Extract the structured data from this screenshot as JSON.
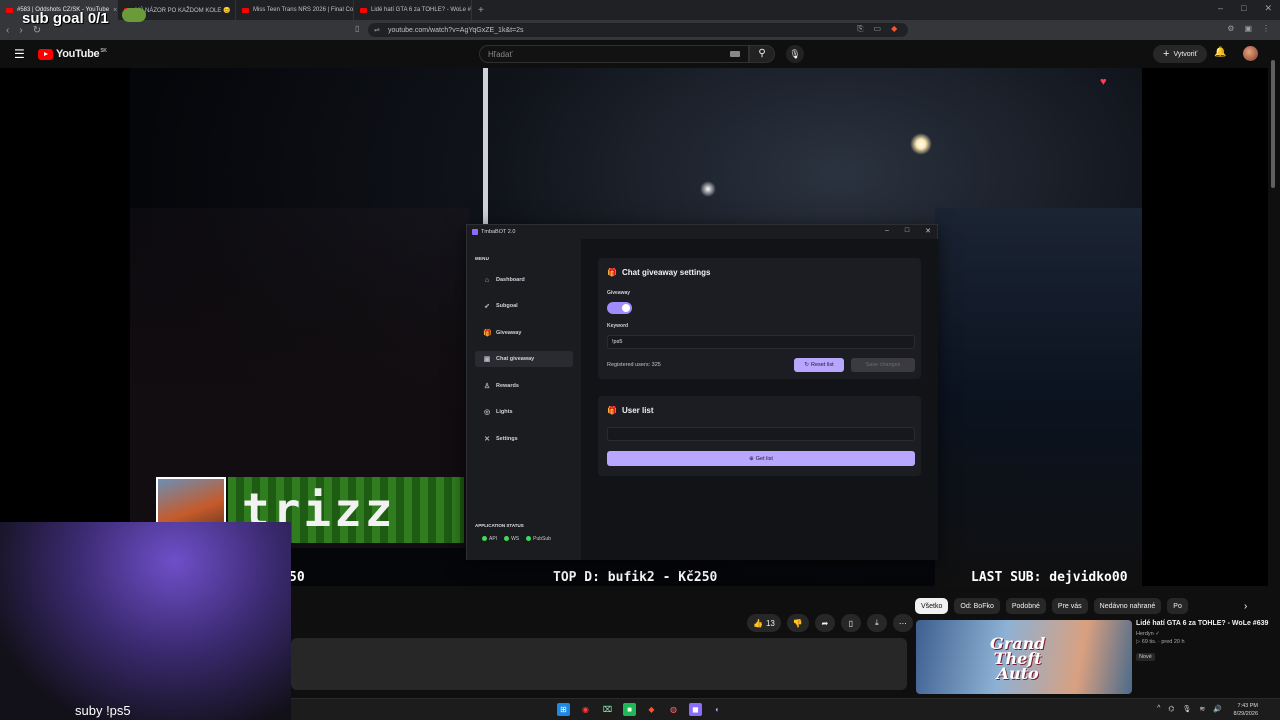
{
  "browser": {
    "tabs": [
      {
        "label": "#583 | Oddshots CZ/SK - YouTube",
        "active": true
      },
      {
        "label": "NÝ NÁZOR PO KAŽDOM KOLE 😊",
        "active": false
      },
      {
        "label": "Miss Teen Trans NRS 2026 | Final Co",
        "active": false
      },
      {
        "label": "Lidé hatí GTA 6 za TOHLE? - WoLe #",
        "active": false
      }
    ],
    "new_tab": "+",
    "url": "youtube.com/watch?v=AgYqGxZE_1k&t=2s"
  },
  "youtube": {
    "logo_text": "YouTube",
    "region": "SK",
    "search_placeholder": "Hľadať",
    "create_label": "Vytvoriť",
    "likes": "13",
    "chips": [
      "Všetko",
      "Od: BoFko",
      "Podobné",
      "Pre vás",
      "Nedávno nahrané",
      "Po"
    ],
    "recommended": {
      "thumb_text_1": "Grand",
      "thumb_text_2": "Theft",
      "thumb_text_3": "Auto",
      "title": "Lidé hatí GTA 6 za TOHLE? - WoLe #639",
      "channel": "Herdyn ✓",
      "meta": "▷ 69 tis. · pred 20 h",
      "badge": "Nové"
    }
  },
  "overlay": {
    "sub_goal": "sub goal 0/1",
    "ticker_left": "50",
    "ticker_top": "TOP D: bufik2 - Kč250",
    "ticker_last": "LAST SUB: dejvidko00",
    "pixel_name": "trizz",
    "webcam_caption": "suby !ps5"
  },
  "bot": {
    "window_title": "TmbaBOT 2.0",
    "menu_header": "MENU",
    "menu": [
      {
        "label": "Dashboard",
        "icon": "home-icon",
        "glyph": "⌂"
      },
      {
        "label": "Subgoal",
        "icon": "rocket-icon",
        "glyph": "➶"
      },
      {
        "label": "Giveaway",
        "icon": "gift-icon",
        "glyph": "🎁"
      },
      {
        "label": "Chat giveaway",
        "icon": "chat-gift-icon",
        "glyph": "▣"
      },
      {
        "label": "Rewards",
        "icon": "award-icon",
        "glyph": "♙"
      },
      {
        "label": "Lights",
        "icon": "bulb-icon",
        "glyph": "◎"
      },
      {
        "label": "Settings",
        "icon": "tools-icon",
        "glyph": "✕"
      }
    ],
    "status_header": "APPLICATION STATUS",
    "status": [
      "API",
      "WS",
      "PubSub"
    ],
    "settings_card": {
      "title": "Chat giveaway settings",
      "giveaway_label": "Giveaway",
      "giveaway_enabled": true,
      "keyword_label": "Keyword",
      "keyword_value": "!ps5",
      "registered": "Registered users: 325",
      "reset_label": "Reset list",
      "save_label": "Save changes"
    },
    "userlist_card": {
      "title": "User list",
      "get_label": "Get list"
    }
  },
  "taskbar": {
    "time": "7:43 PM",
    "date": "8/29/2026"
  },
  "colors": {
    "accent": "#b9a6ff",
    "toggle": "#a08cff",
    "status_ok": "#3ddc5a",
    "youtube_red": "#ff0000"
  }
}
